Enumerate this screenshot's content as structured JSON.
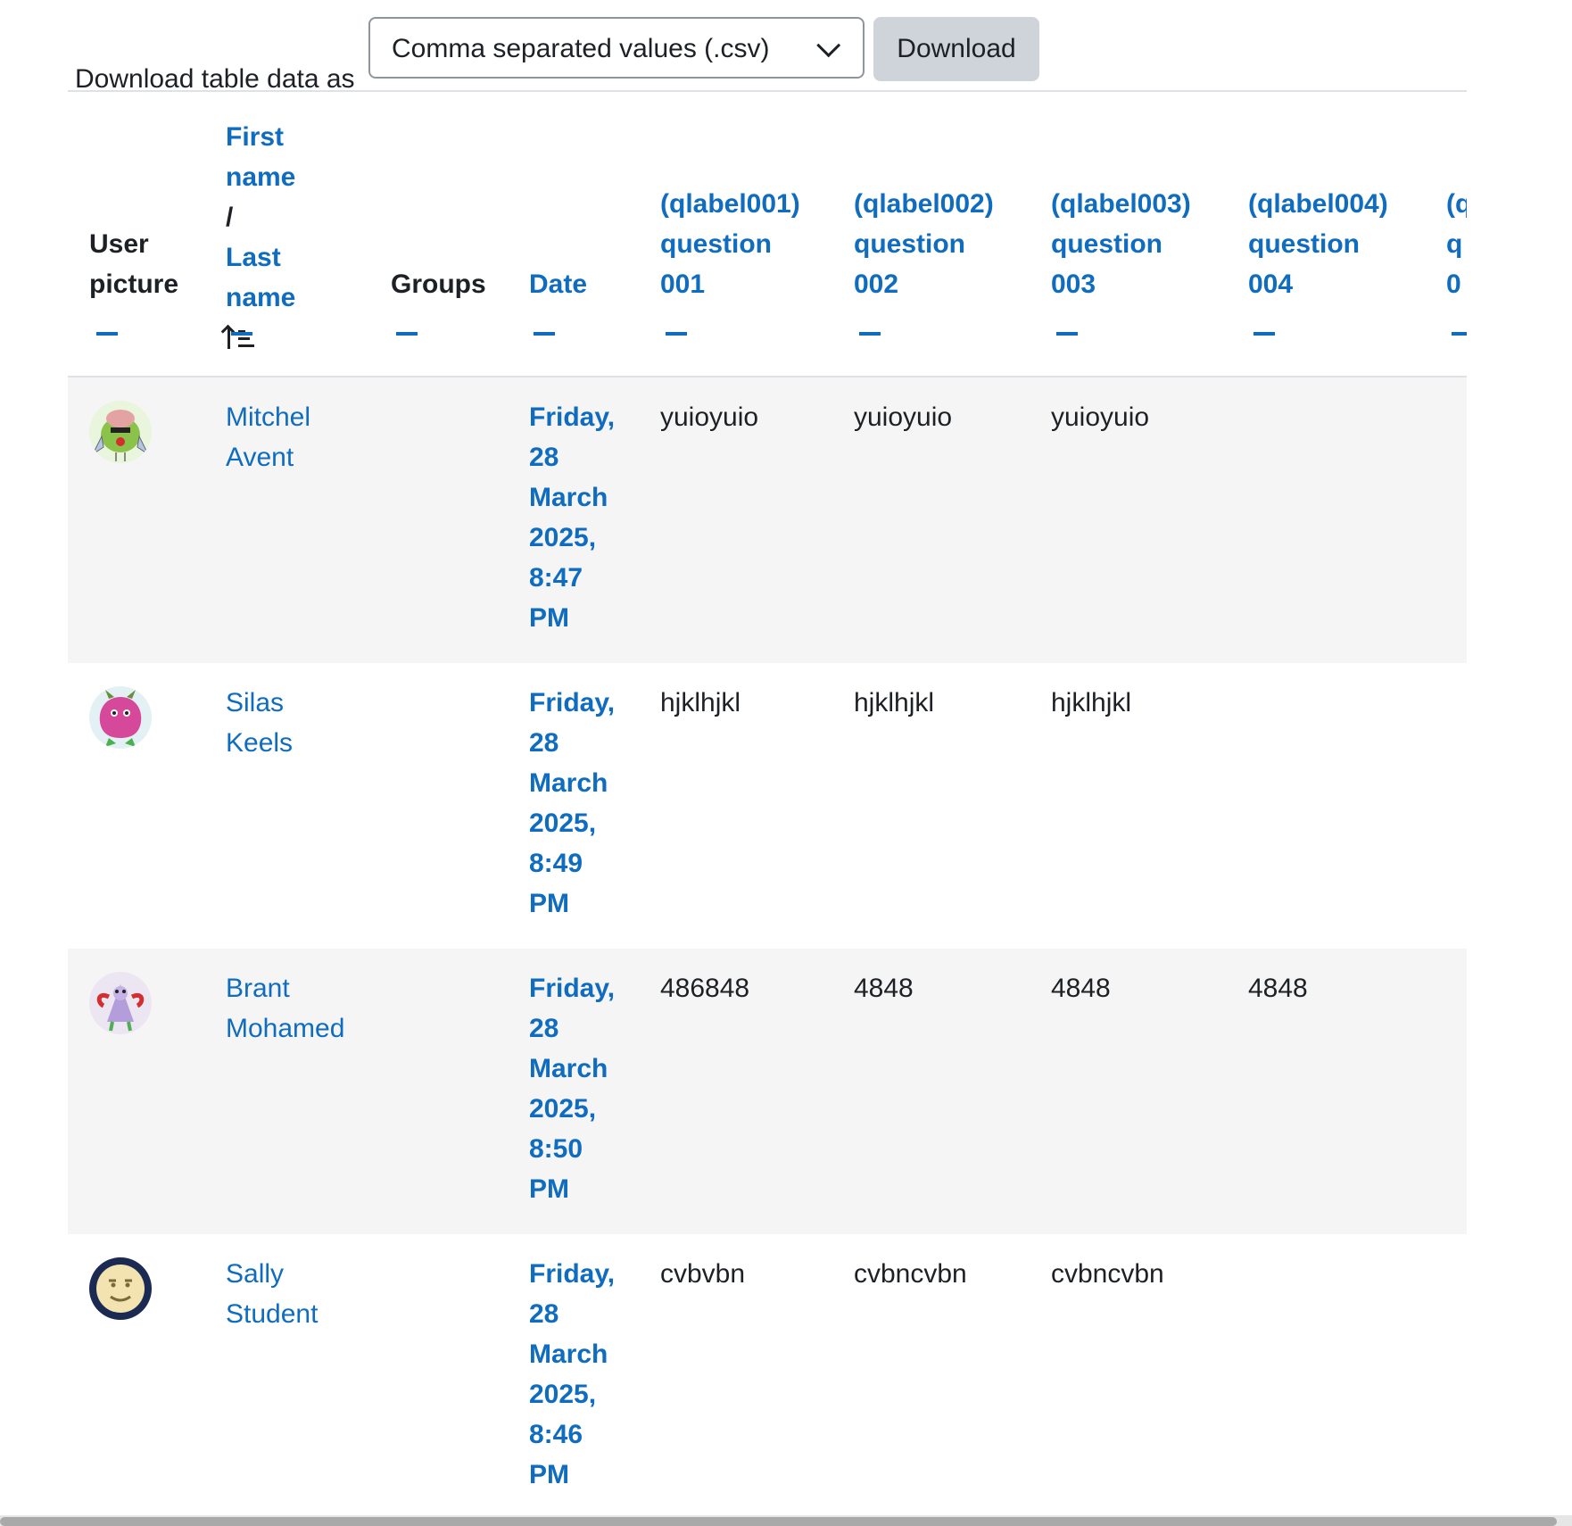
{
  "download": {
    "label": "Download table data as",
    "format_selected": "Comma separated values (.csv)",
    "button": "Download"
  },
  "headers": {
    "picture": [
      "User",
      "picture"
    ],
    "name": {
      "first": "First name",
      "sep": "/",
      "last": "Last name"
    },
    "groups": "Groups",
    "date": "Date",
    "questions": [
      [
        "(qlabel001)",
        "question",
        "001"
      ],
      [
        "(qlabel002)",
        "question",
        "002"
      ],
      [
        "(qlabel003)",
        "question",
        "003"
      ],
      [
        "(qlabel004)",
        "question",
        "004"
      ],
      [
        "(q",
        "q",
        "0"
      ]
    ]
  },
  "rows": [
    {
      "first": "Mitchel",
      "last": "Avent",
      "date": [
        "Friday,",
        "28",
        "March",
        "2025,",
        "8:47",
        "PM"
      ],
      "responses": [
        "yuioyuio",
        "yuioyuio",
        "yuioyuio",
        ""
      ],
      "avatar": "green-monster-avatar"
    },
    {
      "first": "Silas",
      "last": "Keels",
      "date": [
        "Friday,",
        "28",
        "March",
        "2025,",
        "8:49",
        "PM"
      ],
      "responses": [
        "hjklhjkl",
        "hjklhjkl",
        "hjklhjkl",
        ""
      ],
      "avatar": "pink-monster-avatar"
    },
    {
      "first": "Brant",
      "last": "Mohamed",
      "date": [
        "Friday,",
        "28",
        "March",
        "2025,",
        "8:50",
        "PM"
      ],
      "responses": [
        "486848",
        "4848",
        "4848",
        "4848"
      ],
      "avatar": "purple-monster-avatar"
    },
    {
      "first": "Sally",
      "last": "Student",
      "date": [
        "Friday,",
        "28",
        "March",
        "2025,",
        "8:46",
        "PM"
      ],
      "responses": [
        "cvbvbn",
        "cvbncvbn",
        "cvbncvbn",
        ""
      ],
      "avatar": "smiley-avatar"
    }
  ],
  "colors": {
    "link": "#0f6cbf",
    "row_alt": "#f5f5f5",
    "border": "#dee2e6"
  }
}
